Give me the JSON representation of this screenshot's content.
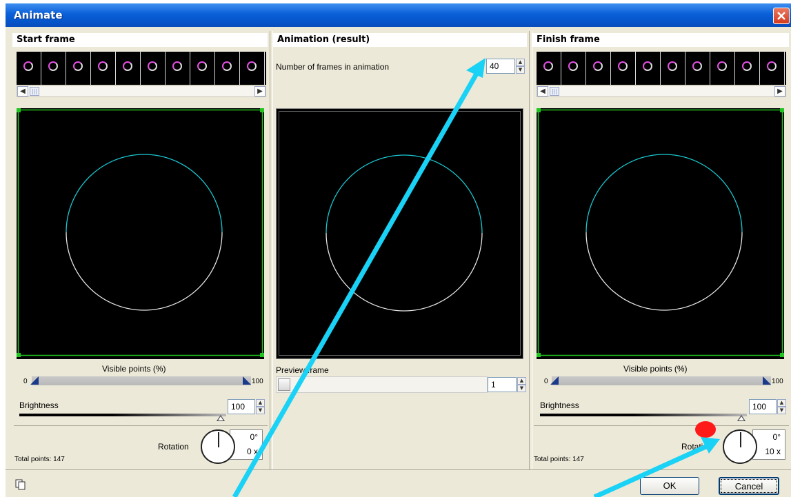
{
  "window": {
    "title": "Animate"
  },
  "start_panel": {
    "heading": "Start frame",
    "visible_points_label": "Visible points (%)",
    "visible_min": "0",
    "visible_max": "100",
    "brightness_label": "Brightness",
    "brightness_value": "100",
    "rotation_label": "Rotation",
    "rotation_degrees": "0°",
    "rotation_times": "0 x",
    "total_points": "Total points: 147"
  },
  "result_panel": {
    "heading": "Animation (result)",
    "frames_label": "Number of frames in animation",
    "frames_value": "40",
    "preview_label": "Preview frame",
    "preview_value": "1"
  },
  "finish_panel": {
    "heading": "Finish frame",
    "visible_points_label": "Visible points (%)",
    "visible_min": "0",
    "visible_max": "100",
    "brightness_label": "Brightness",
    "brightness_value": "100",
    "rotation_label": "Rotation",
    "rotation_degrees": "0°",
    "rotation_times": "10 x",
    "total_points": "Total points: 147"
  },
  "buttons": {
    "ok": "OK",
    "cancel": "Cancel"
  },
  "colors": {
    "title_bar": "#0754c9",
    "frame_border": "#22c422",
    "circle_upper": "#19c8d2",
    "annotation_arrow": "#19d2f5",
    "marker_dot": "#ff1a1a"
  }
}
